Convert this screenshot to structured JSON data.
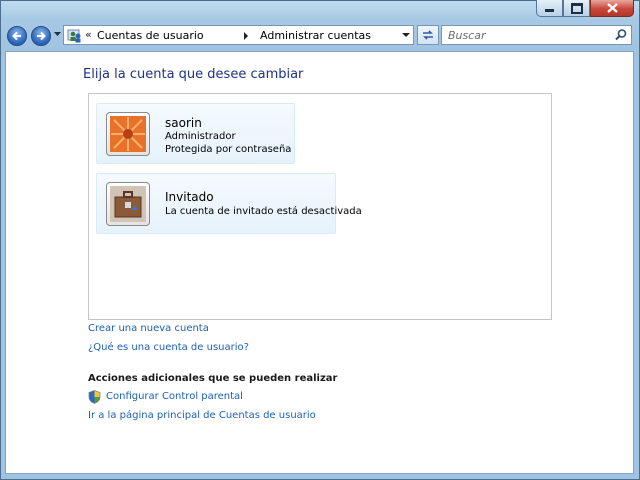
{
  "address": {
    "chevron": "«",
    "crumbs": [
      "Cuentas de usuario",
      "Administrar cuentas"
    ]
  },
  "search": {
    "placeholder": "Buscar"
  },
  "page": {
    "title": "Elija la cuenta que desee cambiar"
  },
  "accounts": [
    {
      "name": "saorin",
      "line1": "Administrador",
      "line2": "Protegida por contraseña",
      "picture": "flower-picture"
    },
    {
      "name": "Invitado",
      "line1": "La cuenta de invitado está desactivada",
      "picture": "briefcase-picture"
    }
  ],
  "links": {
    "create": "Crear una nueva cuenta",
    "what": "¿Qué es una cuenta de usuario?"
  },
  "additional": {
    "heading": "Acciones adicionales que se pueden realizar",
    "parental": "Configurar Control parental",
    "home": "Ir a la página principal de Cuentas de usuario"
  },
  "icons": {
    "back": "back-arrow-icon",
    "forward": "forward-arrow-icon",
    "refresh": "refresh-icon",
    "search": "search-icon",
    "shield": "uac-shield-icon",
    "users": "user-accounts-icon"
  },
  "colors": {
    "link": "#1d5fb7",
    "title": "#1e3287",
    "frame": "#a6c8e4",
    "close": "#c9473a"
  }
}
